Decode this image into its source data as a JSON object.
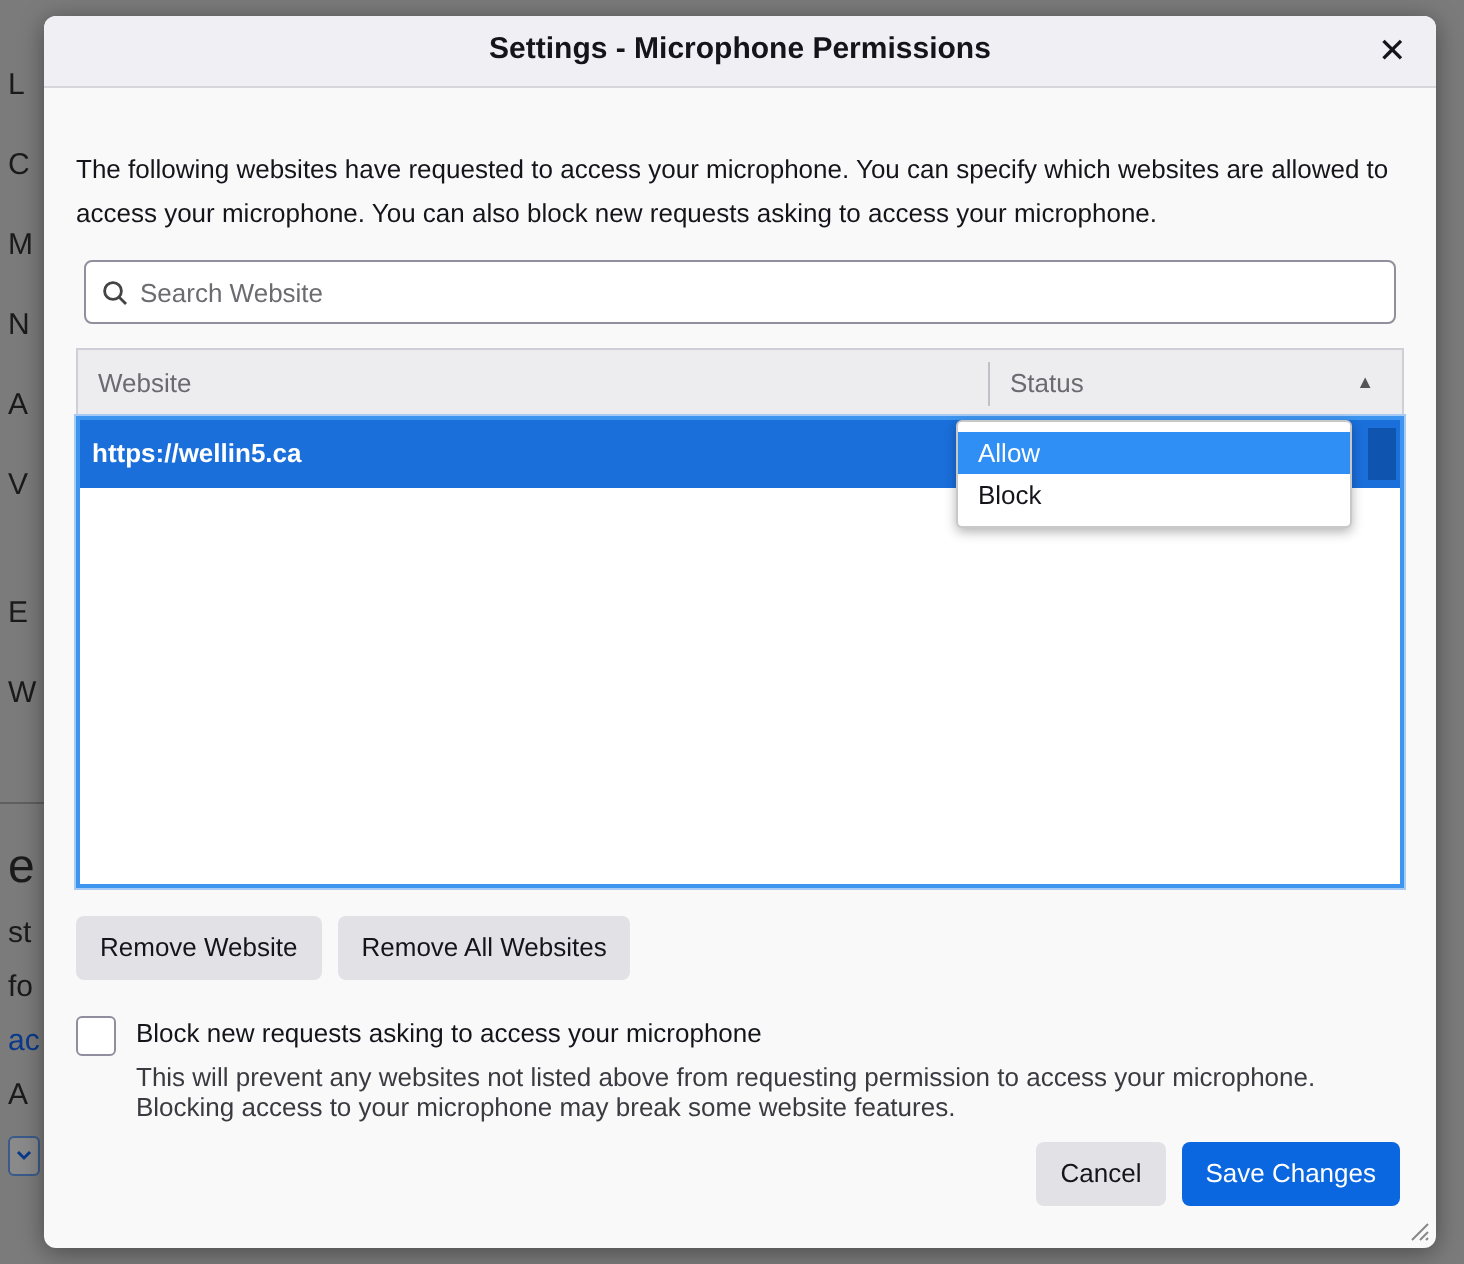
{
  "background_page": {
    "letters": [
      "L",
      "C",
      "M",
      "N",
      "A",
      "V",
      "E",
      "W"
    ],
    "section_heading": "e",
    "lines": [
      {
        "text": "st",
        "kind": "plain"
      },
      {
        "text": "fo",
        "kind": "plain"
      },
      {
        "text": "ac",
        "kind": "link"
      },
      {
        "text": "A",
        "kind": "plain"
      }
    ]
  },
  "dialog": {
    "title": "Settings - Microphone Permissions",
    "close": "✕",
    "description": "The following websites have requested to access your microphone. You can specify which websites are allowed to access your microphone. You can also block new requests asking to access your microphone.",
    "search": {
      "placeholder": "Search Website"
    },
    "table": {
      "columns": [
        "Website",
        "Status"
      ],
      "sort_arrow": "▲",
      "rows": [
        {
          "website": "https://wellin5.ca",
          "selected": true
        }
      ]
    },
    "status_menu": {
      "options": [
        {
          "label": "Allow",
          "selected": true
        },
        {
          "label": "Block",
          "selected": false
        }
      ]
    },
    "buttons": [
      "Remove Website",
      "Remove All Websites"
    ],
    "block_new": {
      "label": "Block new requests asking to access your microphone",
      "checked": false,
      "note": "This will prevent any websites not listed above from requesting permission to access your microphone. Blocking access to your microphone may break some website features."
    },
    "footer_buttons": [
      {
        "label": "Cancel",
        "kind": "secondary"
      },
      {
        "label": "Save Changes",
        "kind": "primary"
      }
    ]
  }
}
